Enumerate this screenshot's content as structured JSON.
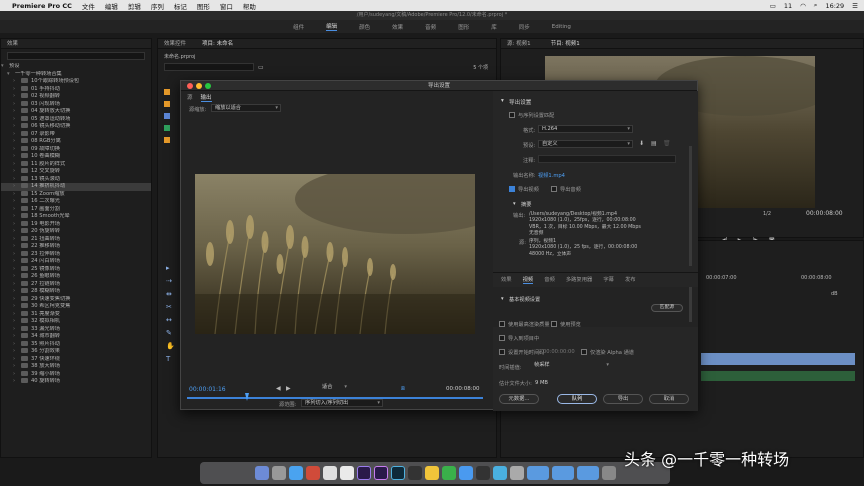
{
  "menubar": {
    "app": "Premiere Pro CC",
    "items": [
      "文件",
      "编辑",
      "剪辑",
      "序列",
      "标记",
      "图形",
      "窗口",
      "帮助"
    ],
    "right": {
      "battery": "11",
      "time": "16:29"
    }
  },
  "window_title": "/用户/sudeyang/文稿/Adobe/Premiere Pro/12.0/未命名.prproj *",
  "workspaces": [
    {
      "label": "组件",
      "active": false
    },
    {
      "label": "编辑",
      "active": true
    },
    {
      "label": "颜色",
      "active": false
    },
    {
      "label": "效果",
      "active": false
    },
    {
      "label": "音频",
      "active": false
    },
    {
      "label": "图形",
      "active": false
    },
    {
      "label": "库",
      "active": false
    },
    {
      "label": "同步",
      "active": false
    },
    {
      "label": "Editing",
      "active": false
    }
  ],
  "effects_panel": {
    "title": "效果",
    "root": "预设",
    "folder": "一千零一种转场合集",
    "items": [
      "10个跟踪转场预设包",
      "01 手持抖动",
      "02 视频翻转",
      "03 闪现转场",
      "04 旋转放大切换",
      "05 遮罩运动转场",
      "06 镜头移动切换",
      "07 录影带",
      "08 RGB分离",
      "09 故障切换",
      "10 卷曲模糊",
      "11 胶片的样式",
      "12 交叉旋转",
      "13 镜头滚动",
      "14 推挤机抖动",
      "15 Zoom缩放",
      "16 二次曝光",
      "17 画面分割",
      "18 Smooth光晕",
      "19 电影开场",
      "20 伪旋转转",
      "21 扭曲转场",
      "22 推移转场",
      "23 拉伸转场",
      "24 闪白转场",
      "25 镜像转场",
      "26 鱼眼转场",
      "27 拉链转场",
      "28 模糊转场",
      "29 快速变焦切换",
      "30 希区柯克变焦",
      "31 亮度渐变",
      "32 模拟相机",
      "33 漏光转场",
      "34 城市翻转",
      "35 照片抖动",
      "36 分割效果",
      "37 快速环绕",
      "38 放大转场",
      "39 缩小转场",
      "40 旋转转场"
    ],
    "selected_index": 14
  },
  "project_panel": {
    "tabs": [
      "效果控件",
      "项目: 未命名"
    ],
    "file": "未命名.prproj",
    "count": "5 个项"
  },
  "program_panel": {
    "tabs": [
      "源: 视频1",
      "节目: 视频1"
    ],
    "zoom": "1/2",
    "timecode": "00:00:08:00"
  },
  "timeline_panel": {
    "marks": [
      "00:00:07:00",
      "00:00:08:00"
    ],
    "db": "dB"
  },
  "dialog": {
    "title": "导出设置",
    "left": {
      "tabs": [
        "源",
        "输出"
      ],
      "active_tab": "输出",
      "scale_label": "源缩放:",
      "scale_value": "缩放以适合",
      "timecode_in": "00:00:01:16",
      "timecode_out": "00:00:08:00",
      "fit": "适合",
      "range_label": "源范围:",
      "range_value": "序列切入/序列切出"
    },
    "right": {
      "section_title": "导出设置",
      "match_sequence": "与序列设置匹配",
      "format_label": "格式:",
      "format_value": "H.264",
      "preset_label": "预设:",
      "preset_value": "自定义",
      "comments_label": "注释:",
      "output_label": "输出名称:",
      "output_value": "视频1.mp4",
      "export_video": "导出视频",
      "export_audio": "导出音频",
      "summary_title": "摘要",
      "summary_out_label": "输出:",
      "summary_out": [
        "/Users/sudeyang/Desktop/视频1.mp4",
        "1920x1080 (1.0)，25fps，逐行，00:00:08:00",
        "VBR，1 次，目标 10.00 Mbps，最大 12.00 Mbps",
        "无音频"
      ],
      "summary_src_label": "源:",
      "summary_src": [
        "序列，视频1",
        "1920x1080 (1.0)，25 fps，逐行，00:00:08:00",
        "48000 Hz，立体声"
      ],
      "tabs": [
        "效果",
        "视频",
        "音频",
        "多路复用器",
        "字幕",
        "发布"
      ],
      "active_tab": "视频",
      "basic_video": "基本视频设置",
      "match_source": "匹配源",
      "max_quality": "使用最高渲染质量",
      "use_previews": "使用预览",
      "import_project": "导入到项目中",
      "set_start_tc": "设置开始时间码",
      "start_tc": "00:00:00:00",
      "alpha_only": "仅渲染 Alpha 通道",
      "interp_label": "时间插值:",
      "interp_value": "帧采样",
      "filesize_label": "估计文件大小:",
      "filesize": "9 MB",
      "metadata_btn": "元数据...",
      "queue_btn": "队列",
      "export_btn": "导出",
      "cancel_btn": "取消"
    }
  },
  "watermark": "头条 @一千零一种转场",
  "colors": {
    "accent": "#4b8ee0",
    "link": "#4d9ff5",
    "bg": "#1e1e1e"
  }
}
